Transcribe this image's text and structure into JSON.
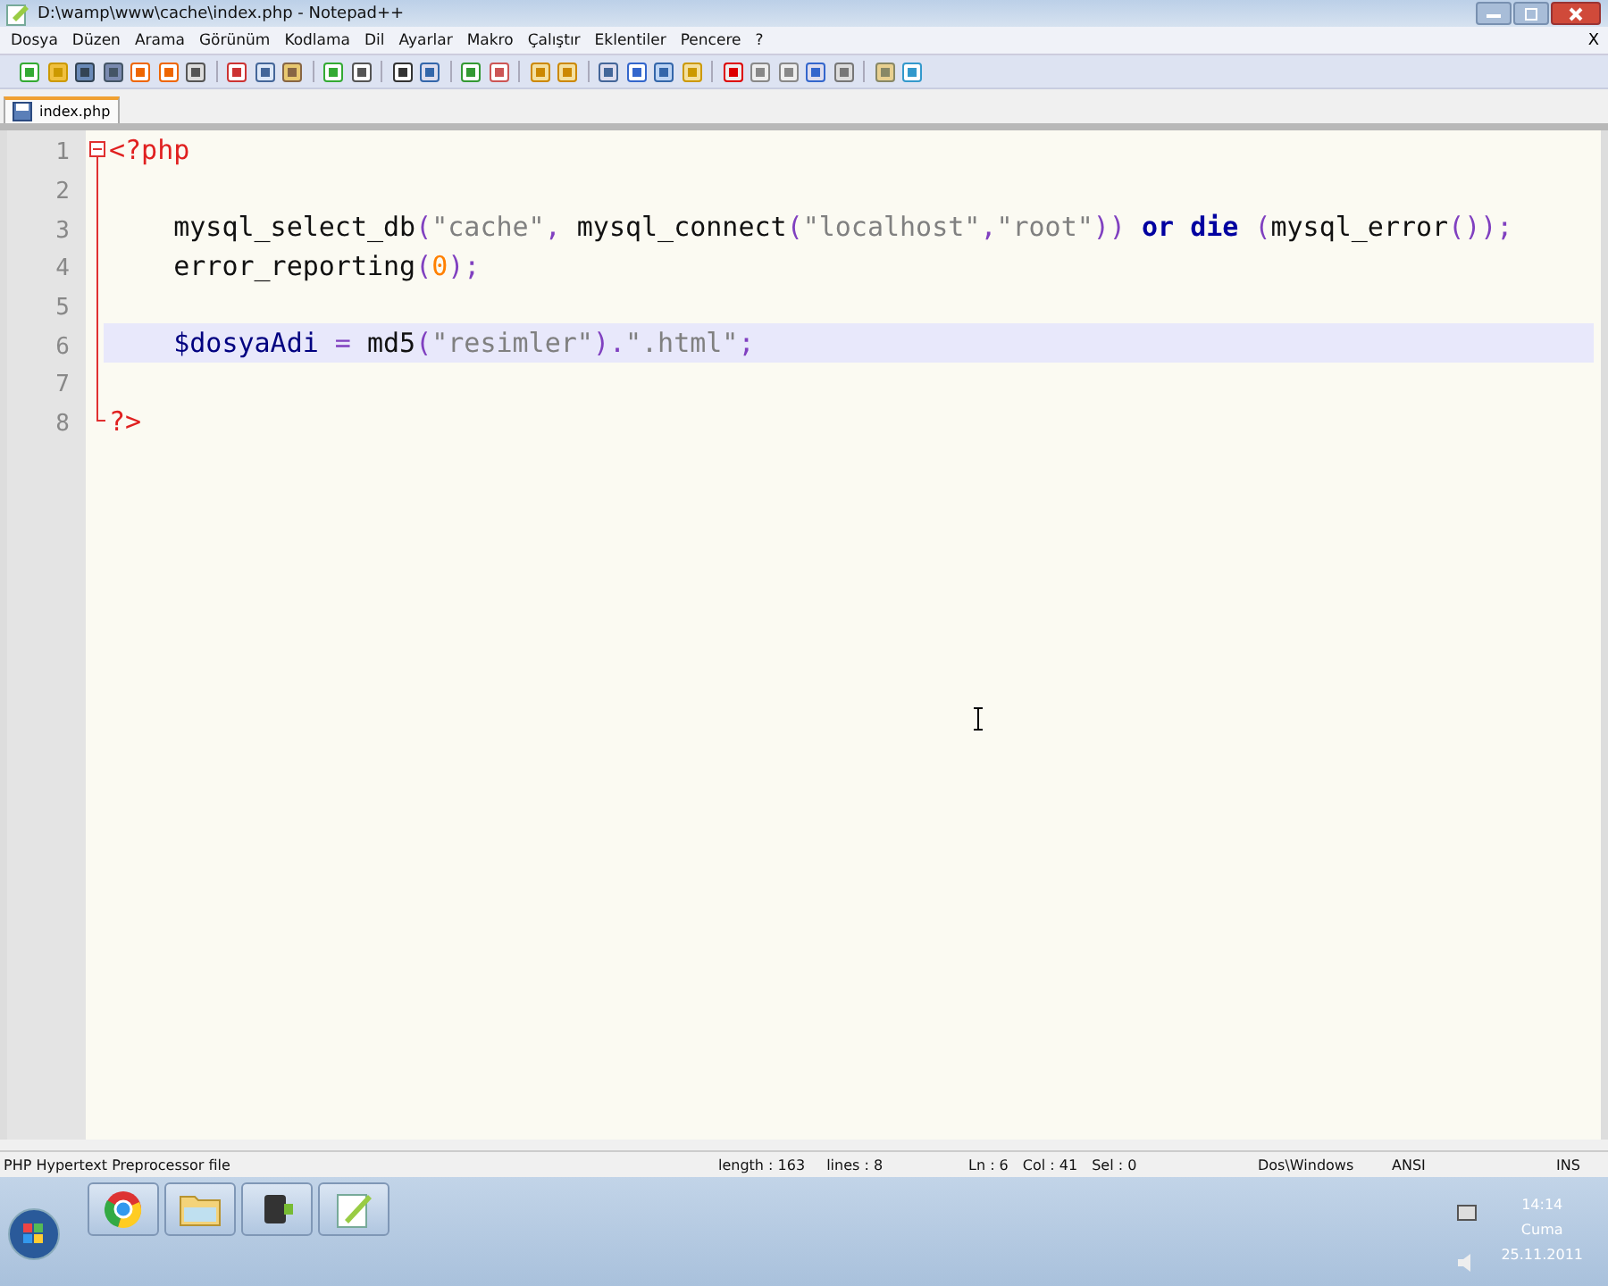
{
  "window": {
    "title": "D:\\wamp\\www\\cache\\index.php - Notepad++"
  },
  "menu": [
    "Dosya",
    "Düzen",
    "Arama",
    "Görünüm",
    "Kodlama",
    "Dil",
    "Ayarlar",
    "Makro",
    "Çalıştır",
    "Eklentiler",
    "Pencere",
    "?"
  ],
  "menu_close": "X",
  "tabs": [
    {
      "label": "index.php",
      "selected": true
    }
  ],
  "editor": {
    "lines": [
      {
        "number": "1",
        "current": false,
        "tokens": [
          {
            "kind": "tag",
            "text": "<?php"
          }
        ]
      },
      {
        "number": "2",
        "current": false
      },
      {
        "number": "3",
        "current": false,
        "tokens": [
          {
            "kind": "plain",
            "text": "    mysql_select_db"
          },
          {
            "kind": "op",
            "text": "("
          },
          {
            "kind": "string",
            "text": "\"cache\""
          },
          {
            "kind": "op",
            "text": ","
          },
          {
            "kind": "plain",
            "text": " mysql_connect"
          },
          {
            "kind": "op",
            "text": "("
          },
          {
            "kind": "string",
            "text": "\"localhost\""
          },
          {
            "kind": "op",
            "text": ","
          },
          {
            "kind": "string",
            "text": "\"root\""
          },
          {
            "kind": "op",
            "text": "))"
          },
          {
            "kind": "keyword",
            "text": " or"
          },
          {
            "kind": "keyword",
            "text": " die"
          },
          {
            "kind": "op",
            "text": " ("
          },
          {
            "kind": "plain",
            "text": "mysql_error"
          },
          {
            "kind": "op",
            "text": "());"
          }
        ]
      },
      {
        "number": "4",
        "current": false,
        "tokens": [
          {
            "kind": "plain",
            "text": "    error_reporting"
          },
          {
            "kind": "op",
            "text": "("
          },
          {
            "kind": "number",
            "text": "0"
          },
          {
            "kind": "op",
            "text": ");"
          }
        ]
      },
      {
        "number": "5",
        "current": false
      },
      {
        "number": "6",
        "current": true,
        "tokens": [
          {
            "kind": "variable",
            "text": "    $dosyaAdi"
          },
          {
            "kind": "op",
            "text": " ="
          },
          {
            "kind": "plain",
            "text": " md5"
          },
          {
            "kind": "op",
            "text": "("
          },
          {
            "kind": "string",
            "text": "\"resimler\""
          },
          {
            "kind": "op",
            "text": ")."
          },
          {
            "kind": "string",
            "text": "\".html\""
          },
          {
            "kind": "op",
            "text": ";"
          }
        ]
      },
      {
        "number": "7",
        "current": false
      },
      {
        "number": "8",
        "current": false,
        "tokens": [
          {
            "kind": "tag",
            "text": "?>"
          }
        ]
      }
    ]
  },
  "status_bar": {
    "file_type": "PHP Hypertext Preprocessor file",
    "length": "length : 163",
    "lines": "lines : 8",
    "ln": "Ln : 6",
    "col": "Col : 41",
    "sel": "Sel : 0",
    "eol": "Dos\\Windows",
    "encoding": "ANSI",
    "mode": "INS"
  },
  "taskbar": {
    "clock": {
      "time": "14:14",
      "day": "Cuma",
      "date": "25.11.2011"
    }
  }
}
